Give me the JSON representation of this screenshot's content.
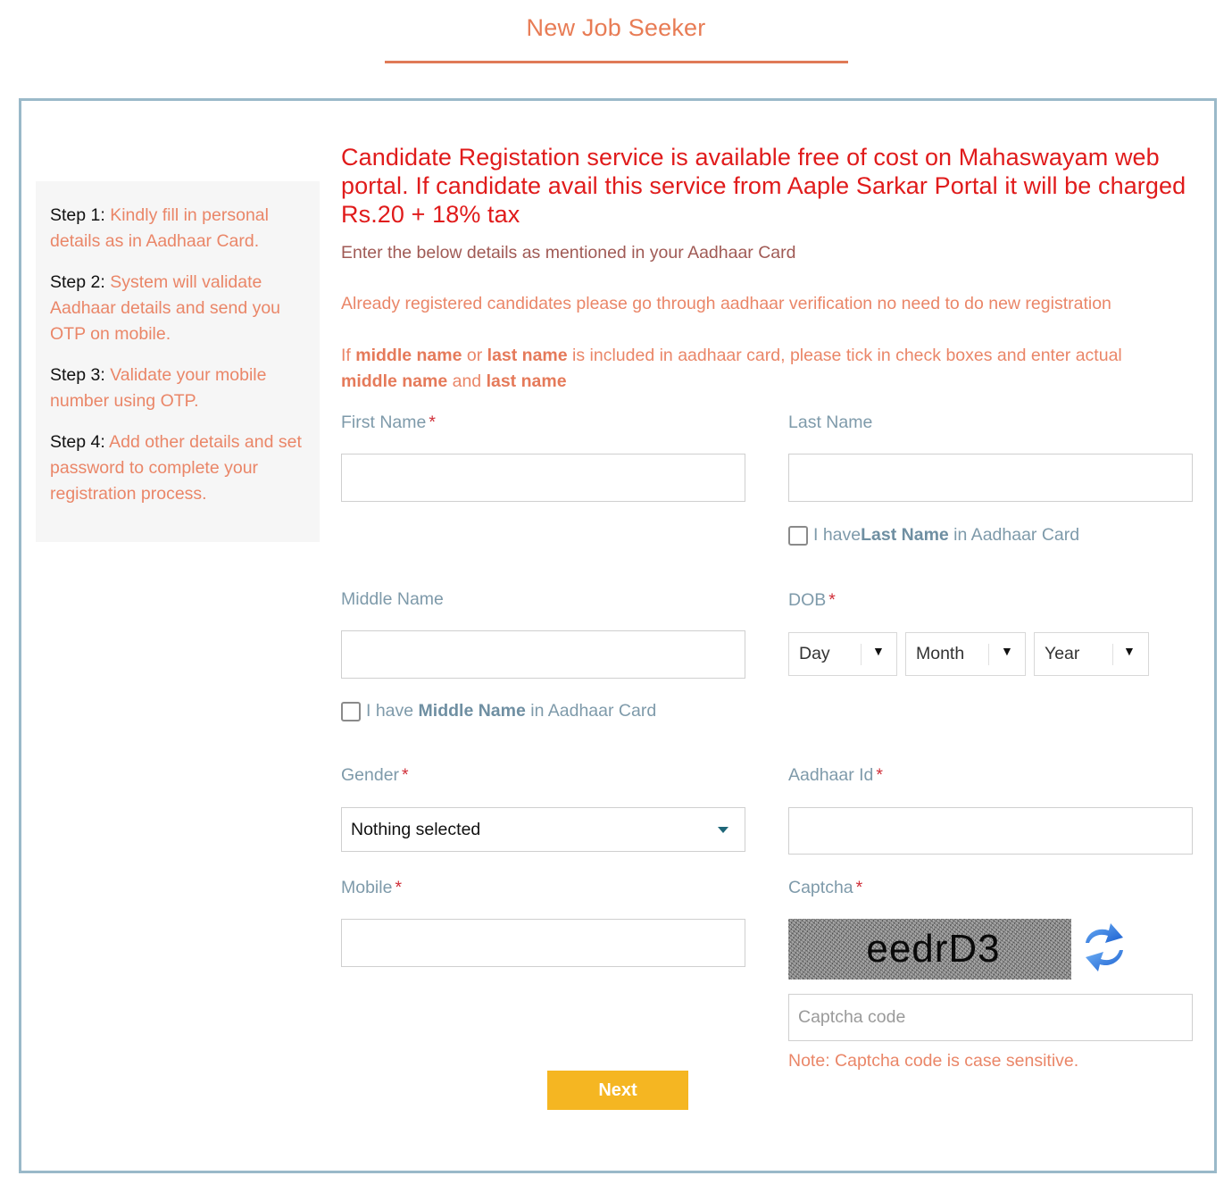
{
  "header": {
    "title": "New Job Seeker"
  },
  "steps": [
    {
      "label": "Step 1:",
      "text": "Kindly fill in personal details as in Aadhaar Card."
    },
    {
      "label": "Step 2:",
      "text": "System will validate Aadhaar details and send you OTP on mobile."
    },
    {
      "label": "Step 3:",
      "text": "Validate your mobile number using OTP."
    },
    {
      "label": "Step 4:",
      "text": "Add other details and set password to complete your registration process."
    }
  ],
  "notices": {
    "warning": "Candidate Registation service is available free of cost on Mahaswayam web portal. If candidate avail this service from Aaple Sarkar Portal it will be charged Rs.20 + 18% tax",
    "intro": "Enter the below details as mentioned in your Aadhaar Card",
    "already_registered": "Already registered candidates please go through aadhaar verification no need to do new registration",
    "name_note": {
      "p1": "If ",
      "b1": "middle name",
      "p2": " or ",
      "b2": "last name",
      "p3": " is included in aadhaar card, please tick in check boxes and enter actual ",
      "b3": "middle name",
      "p4": " and ",
      "b4": "last name"
    }
  },
  "form": {
    "required_mark": "*",
    "first_name": {
      "label": "First Name",
      "value": "",
      "required": true
    },
    "last_name": {
      "label": "Last Name",
      "value": "",
      "required": false
    },
    "last_name_check": {
      "prefix": "I have",
      "bold": "Last Name",
      "suffix": " in Aadhaar Card",
      "checked": false
    },
    "middle_name": {
      "label": "Middle Name",
      "value": "",
      "required": false
    },
    "middle_name_check": {
      "prefix": "I have ",
      "bold": "Middle Name",
      "suffix": " in Aadhaar Card",
      "checked": false
    },
    "dob": {
      "label": "DOB",
      "required": true,
      "day": "Day",
      "month": "Month",
      "year": "Year",
      "arrow": "▼"
    },
    "gender": {
      "label": "Gender",
      "selected": "Nothing selected",
      "required": true
    },
    "aadhaar_id": {
      "label": "Aadhaar Id",
      "value": "",
      "required": true
    },
    "mobile": {
      "label": "Mobile",
      "value": "",
      "required": true
    },
    "captcha": {
      "label": "Captcha",
      "required": true,
      "image_text": "eedrD3",
      "placeholder": "Captcha code",
      "note": "Note: Captcha code is case sensitive."
    },
    "next_label": "Next"
  },
  "colors": {
    "accent": "#e87c55",
    "warning": "#e01b1b",
    "label": "#7e9aaa",
    "button": "#f5b622",
    "panel_border": "#9ab9c9"
  }
}
